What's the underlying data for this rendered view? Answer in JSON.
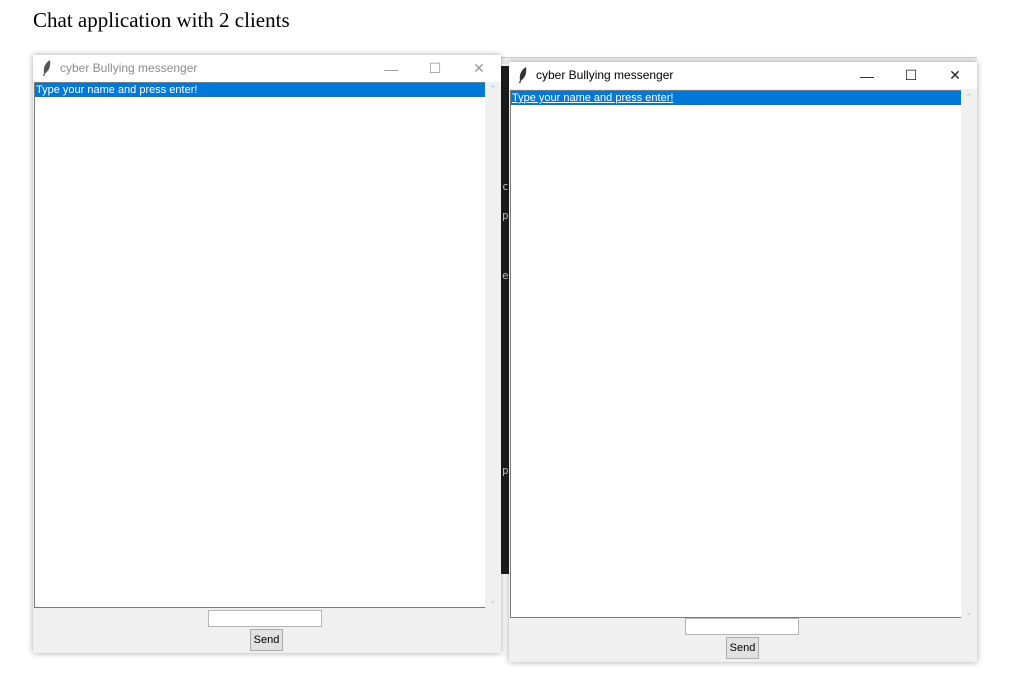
{
  "heading": "Chat application with 2 clients",
  "background_terminal": {
    "fragments": [
      "c",
      "p",
      "e",
      "p"
    ]
  },
  "windows": [
    {
      "title": "cyber Bullying messenger",
      "active": false,
      "controls": {
        "minimize": "—",
        "maximize": "☐",
        "close": "✕"
      },
      "messages": [
        "Type your name and press enter!"
      ],
      "input_value": "",
      "send_label": "Send"
    },
    {
      "title": "cyber Bullying messenger",
      "active": true,
      "controls": {
        "minimize": "—",
        "maximize": "☐",
        "close": "✕"
      },
      "messages": [
        "Type your name and press enter!"
      ],
      "input_value": "",
      "send_label": "Send"
    }
  ],
  "icons": {
    "app": "feather-icon",
    "scroll_up": "chevron-up-icon",
    "scroll_down": "chevron-down-icon"
  },
  "colors": {
    "selection": "#0078d7",
    "window_bg": "#f0f0f0",
    "inactive_title": "#8c8c8c"
  }
}
